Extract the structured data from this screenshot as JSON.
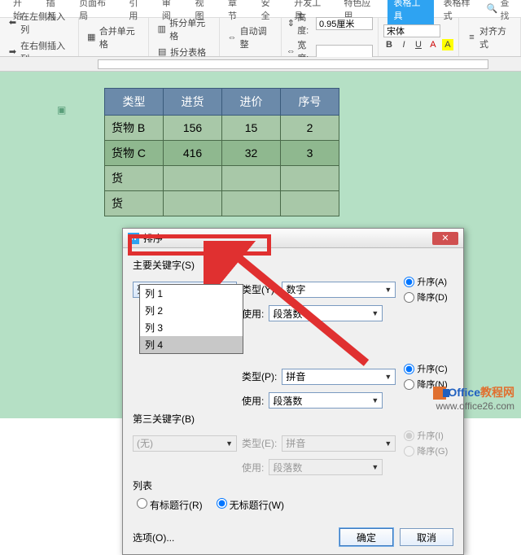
{
  "ribbon": {
    "tabs": [
      "开始",
      "插入",
      "页面布局",
      "引用",
      "审阅",
      "视图",
      "章节",
      "安全",
      "开发工具",
      "特色应用"
    ],
    "active1": "表格工具",
    "active2": "表格样式",
    "search": "查找"
  },
  "toolbar": {
    "insert_left": "在左侧插入列",
    "insert_right": "在右侧插入列",
    "merge": "合并单元格",
    "split_cell": "拆分单元格",
    "split_table": "拆分表格",
    "autofit": "自动调整",
    "height_label": "高度:",
    "height_val": "0.95厘米",
    "width_label": "宽度:",
    "font": "宋体",
    "align": "对齐方式"
  },
  "table": {
    "headers": [
      "类型",
      "进货",
      "进价",
      "序号"
    ],
    "rows": [
      [
        "货物 B",
        "156",
        "15",
        "2"
      ],
      [
        "货物 C",
        "416",
        "32",
        "3"
      ],
      [
        "货",
        "",
        "",
        ""
      ],
      [
        "货",
        "",
        "",
        ""
      ]
    ]
  },
  "dialog": {
    "title": "排序",
    "key1_label": "主要关键字(S)",
    "key1_value": "列 4",
    "type_label": "类型(Y):",
    "type1_value": "数字",
    "use_label": "使用:",
    "use1_value": "段落数",
    "asc": "升序(A)",
    "desc": "降序(D)",
    "dropdown_items": [
      "列 1",
      "列 2",
      "列 3",
      "列 4"
    ],
    "key2_type_label": "类型(P):",
    "type2_value": "拼音",
    "use2_value": "段落数",
    "asc2": "升序(C)",
    "desc2": "降序(N)",
    "key3_label": "第三关键字(B)",
    "key3_value": "(无)",
    "type3_value": "拼音",
    "use3_value": "段落数",
    "asc3": "升序(I)",
    "desc3": "降序(G)",
    "list_label": "列表",
    "has_header": "有标题行(R)",
    "no_header": "无标题行(W)",
    "options": "选项(O)...",
    "ok": "确定",
    "cancel": "取消",
    "type3_label": "类型(E):"
  },
  "watermark": {
    "line1a": "Office",
    "line1b": "教程网",
    "line2": "www.office26.com"
  }
}
